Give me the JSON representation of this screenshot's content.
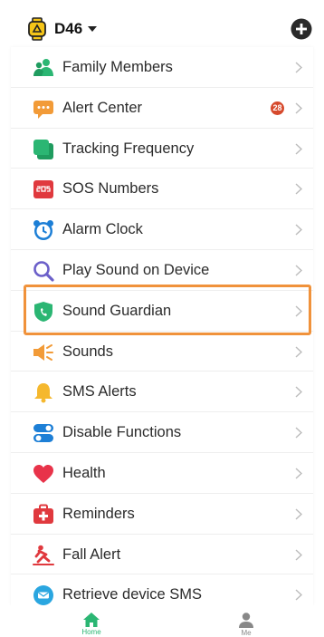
{
  "header": {
    "device_name": "D46",
    "device_icon": "watch-icon",
    "add_icon": "plus-circle-icon"
  },
  "menu": {
    "items": [
      {
        "label": "Family Members",
        "icon": "family-icon",
        "color": "#2bb673"
      },
      {
        "label": "Alert Center",
        "icon": "chat-bubble-icon",
        "color": "#f29b38",
        "badge": "28"
      },
      {
        "label": "Tracking Frequency",
        "icon": "tracking-icon",
        "color": "#2bb673"
      },
      {
        "label": "SOS Numbers",
        "icon": "sos-icon",
        "color": "#e0393e"
      },
      {
        "label": "Alarm Clock",
        "icon": "alarm-clock-icon",
        "color": "#1d7fd6"
      },
      {
        "label": "Play Sound on Device",
        "icon": "magnifier-icon",
        "color": "#6b5fc9"
      },
      {
        "label": "Sound Guardian",
        "icon": "shield-icon",
        "color": "#2bb673"
      },
      {
        "label": "Sounds",
        "icon": "speaker-icon",
        "color": "#f29b38"
      },
      {
        "label": "SMS Alerts",
        "icon": "bell-icon",
        "color": "#f5b82e"
      },
      {
        "label": "Disable Functions",
        "icon": "toggle-icon",
        "color": "#1d7fd6"
      },
      {
        "label": "Health",
        "icon": "heart-icon",
        "color": "#e8334a"
      },
      {
        "label": "Reminders",
        "icon": "medical-kit-icon",
        "color": "#e0393e"
      },
      {
        "label": "Fall Alert",
        "icon": "falling-person-icon",
        "color": "#e0393e"
      },
      {
        "label": "Retrieve device SMS",
        "icon": "message-icon",
        "color": "#2aa6e0"
      }
    ],
    "highlighted_item": "Sound Guardian",
    "highlight_color": "#f0923b"
  },
  "tabbar": {
    "home_label": "Home",
    "me_label": "Me",
    "active_color": "#2bb673",
    "inactive_color": "#888888"
  }
}
